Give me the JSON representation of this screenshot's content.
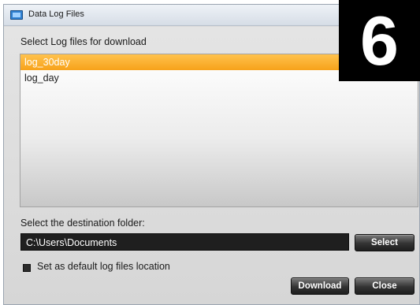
{
  "window": {
    "title": "Data Log Files"
  },
  "files_section": {
    "label": "Select Log files for download",
    "items": [
      {
        "label": "log_30day",
        "selected": true
      },
      {
        "label": "log_day",
        "selected": false
      }
    ]
  },
  "destination": {
    "label": "Select the destination folder:",
    "path": "C:\\Users\\Documents",
    "select_button": "Select"
  },
  "default_option": {
    "label": "Set as default log files location"
  },
  "actions": {
    "download_button": "Download",
    "close_button": "Close"
  },
  "step_badge": "6",
  "colors": {
    "selection": "#f7a21a",
    "path_field_bg": "#1f1f1f",
    "button_bg": "#333333"
  }
}
